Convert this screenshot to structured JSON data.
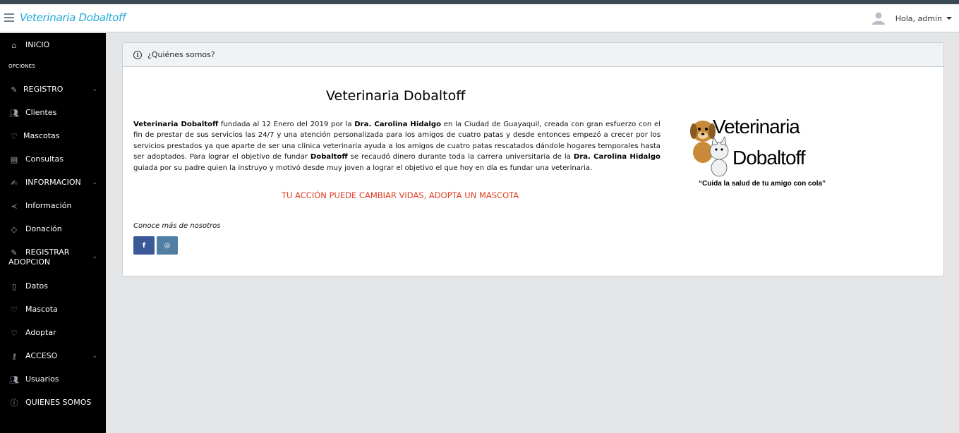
{
  "navbar": {
    "brand": "Veterinaria Dobaltoff",
    "greeting": "Hola, admin"
  },
  "sidebar": {
    "items": [
      {
        "label": "INICIO",
        "icon": "home-icon"
      },
      {
        "label": "OPCIONES",
        "kind": "title"
      },
      {
        "label": "REGISTRO",
        "icon": "pencil-icon",
        "has_children": true
      },
      {
        "label": "Clientes",
        "icon": "users-icon"
      },
      {
        "label": "Mascotas",
        "icon": "heart-icon"
      },
      {
        "label": "Consultas",
        "icon": "book-icon"
      },
      {
        "label": "INFORMACION",
        "icon": "note-icon",
        "has_children": true
      },
      {
        "label": "Información",
        "icon": "share-icon"
      },
      {
        "label": "Donación",
        "icon": "tag-icon"
      },
      {
        "label": "REGISTRAR ADOPCION",
        "icon": "pencil-icon",
        "has_children": true
      },
      {
        "label": "Datos",
        "icon": "doc-icon"
      },
      {
        "label": "Mascota",
        "icon": "heart-icon"
      },
      {
        "label": "Adoptar",
        "icon": "heart-icon"
      },
      {
        "label": "ACCESO",
        "icon": "key-icon",
        "has_children": true
      },
      {
        "label": "Usuarios",
        "icon": "users-icon"
      },
      {
        "label": "QUIENES SOMOS",
        "icon": "info-icon"
      }
    ]
  },
  "card": {
    "header": "¿Quiénes somos?",
    "title": "Veterinaria Dobaltoff",
    "paragraph": {
      "p1_bold": "Veterinaria Dobaltoff",
      "p2": " fundada al 12 Enero del 2019 por la ",
      "p3_bold": "Dra. Carolina Hidalgo",
      "p4": " en la Ciudad de Guayaquil, creada con gran esfuerzo con el fin de prestar de sus servicios las 24/7 y una atención personalizada para los amigos de cuatro patas y desde entonces empezó a crecer por los servicios prestados ya que aparte de ser una clínica veterinaria ayuda a los amigos de cuatro patas rescatados dándole hogares temporales hasta ser adoptados. Para lograr el objetivo de fundar ",
      "p5_bold": "Dobaltoff",
      "p6": " se recaudó dinero durante toda la carrera universitaria de la ",
      "p7_bold": "Dra. Carolina Hidalgo",
      "p8": " guiada por su padre quien la instruyo y motivó desde muy joven a lograr el objetivo el que hoy en día es fundar una veterinaria."
    },
    "slogan": "TU ACCIÓN PUEDE CAMBIAR VIDAS, ADOPTA UN MASCOTA",
    "conoce": "Conoce más de nosotros",
    "social": {
      "facebook": "f",
      "instagram": "◎"
    },
    "logo": {
      "line1": "Veterinaria",
      "line2": "Dobaltoff",
      "tagline": "“Cuida la salud de tu amigo con cola”"
    }
  },
  "colors": {
    "brand": "#20a8d8",
    "sidebar_bg": "#000000",
    "slogan": "#e03c1f",
    "facebook": "#3b5998",
    "instagram": "#517fa4"
  }
}
